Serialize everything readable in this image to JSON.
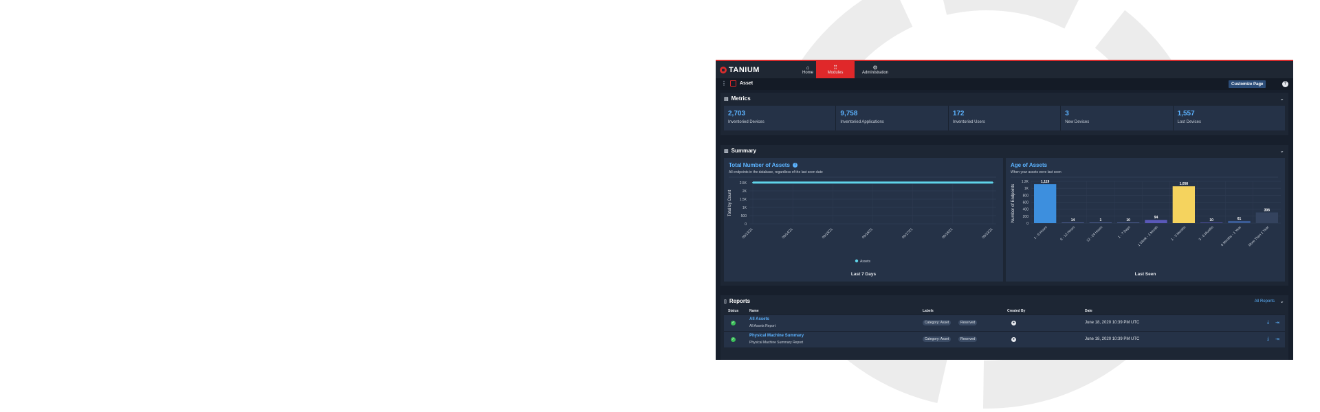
{
  "nav": {
    "brand": "TANIUM",
    "items": [
      {
        "label": "Home",
        "icon": "home-icon",
        "glyph": "⌂"
      },
      {
        "label": "Modules",
        "icon": "grid-icon",
        "glyph": "⠿"
      },
      {
        "label": "Administration",
        "icon": "gear-icon",
        "glyph": "⚙"
      }
    ]
  },
  "breadcrumb": {
    "title": "Asset"
  },
  "customize_label": "Customize Page",
  "help_glyph": "?",
  "metrics": {
    "title": "Metrics",
    "items": [
      {
        "value": "2,703",
        "label": "Inventoried Devices"
      },
      {
        "value": "9,758",
        "label": "Inventoried Applications"
      },
      {
        "value": "172",
        "label": "Inventoried Users"
      },
      {
        "value": "3",
        "label": "New Devices"
      },
      {
        "value": "1,557",
        "label": "Lost Devices"
      }
    ]
  },
  "summary": {
    "title": "Summary"
  },
  "chart_data": [
    {
      "type": "line",
      "title": "Total Number of Assets",
      "subtitle": "All endpoints in the database, regardless of the last seen date",
      "xlabel": "Last 7 Days",
      "ylabel": "Total by Count",
      "x": [
        "09/13/21",
        "09/14/21",
        "09/15/21",
        "09/16/21",
        "09/17/21",
        "09/18/21",
        "09/19/21"
      ],
      "yticks": [
        "0",
        "500",
        "1K",
        "1.5K",
        "2K",
        "2.5K"
      ],
      "ylim": [
        0,
        2700
      ],
      "series": [
        {
          "name": "Assets",
          "values": [
            2703,
            2703,
            2703,
            2703,
            2703,
            2703,
            2703
          ]
        }
      ],
      "legend": "bottom",
      "grid": true,
      "colors": {
        "line": "#5fd3e8"
      }
    },
    {
      "type": "bar",
      "title": "Age of Assets",
      "subtitle": "When your assets were last seen",
      "xlabel": "Last Seen",
      "ylabel": "Number of Endpoints",
      "categories": [
        "1 - 6 Hours",
        "6 - 12 Hours",
        "12 - 24 Hours",
        "1 - 7 Days",
        "1 Week - 1 Month",
        "1 - 3 Months",
        "3 - 6 Months",
        "6 Months - 1 Year",
        "More Than 1 Year"
      ],
      "values": [
        1119,
        14,
        1,
        10,
        94,
        1058,
        10,
        61,
        306
      ],
      "yticks": [
        "0",
        "200",
        "400",
        "600",
        "800",
        "1K",
        "1.2K"
      ],
      "ylim": [
        0,
        1200
      ],
      "grid": true,
      "colors": [
        "#3d8fde",
        "#5a6ba8",
        "#5a6ba8",
        "#5a6ba8",
        "#5a58b8",
        "#f5d35e",
        "#5a58b8",
        "#3b5c96",
        "#34435e"
      ]
    }
  ],
  "reports": {
    "title": "Reports",
    "all_link": "All Reports",
    "headers": {
      "status": "Status",
      "name": "Name",
      "labels": "Labels",
      "created": "Created By",
      "date": "Date"
    },
    "rows": [
      {
        "name": "All Assets",
        "desc": "All Assets Report",
        "labels": [
          "Category: Asset",
          "Reserved"
        ],
        "date": "June 18, 2020 10:39 PM UTC"
      },
      {
        "name": "Physical Machine Summary",
        "desc": "Physical Machine Summary Report",
        "labels": [
          "Category: Asset",
          "Reserved"
        ],
        "date": "June 18, 2020 10:39 PM UTC"
      }
    ]
  }
}
